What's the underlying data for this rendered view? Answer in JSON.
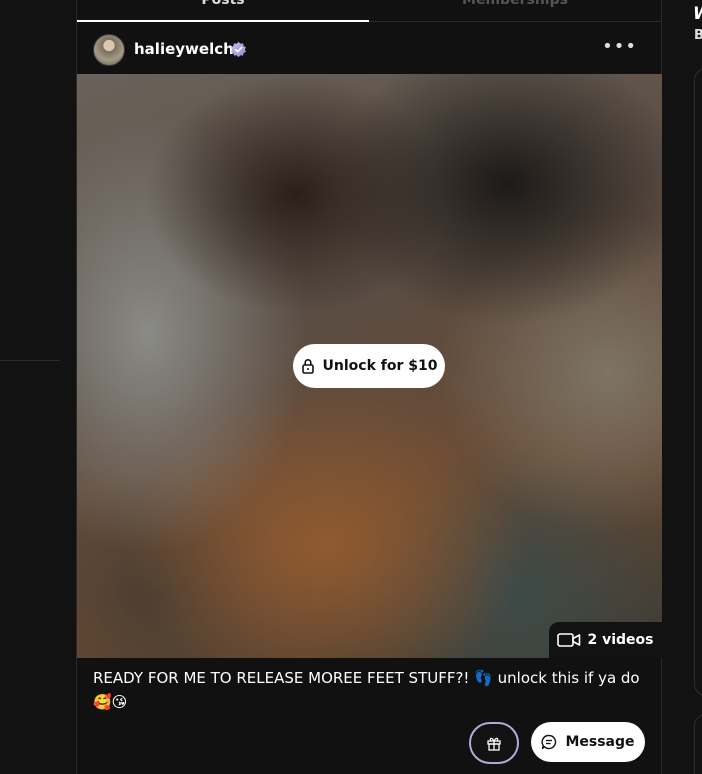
{
  "tabs": {
    "posts": "Posts",
    "memberships": "Memberships"
  },
  "post": {
    "username": "halieywelch",
    "unlock_label": "Unlock for $10",
    "videos_label": "2 videos",
    "caption": "READY FOR ME TO RELEASE MOREE FEET STUFF?! 👣 unlock this if ya do 🥰😘",
    "message_label": "Message"
  },
  "right": {
    "title": "W",
    "subtitle": "B"
  },
  "icons": {
    "verified": "verified-badge-icon",
    "more": "more-options-icon",
    "lock": "lock-icon",
    "video": "video-camera-icon",
    "gift": "gift-icon",
    "message": "chat-bubble-icon"
  },
  "colors": {
    "background": "#121212",
    "accent_border": "#b9a6d8",
    "button_bg": "#ffffff"
  }
}
